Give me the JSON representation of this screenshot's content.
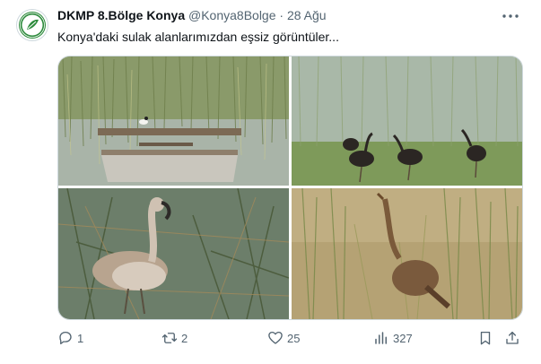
{
  "tweet": {
    "display_name": "DKMP 8.Bölge Konya",
    "handle": "@Konya8Bolge",
    "separator": "·",
    "date": "28 Ağu",
    "text": "Konya'daki sulak alanlarımızdan eşsiz görüntüler...",
    "avatar_icon": "dkmp-logo-icon",
    "photos": [
      {
        "subject": "boat-in-reeds-with-bird",
        "icon": "photo-icon"
      },
      {
        "subject": "glossy-ibises-in-grass",
        "icon": "photo-icon"
      },
      {
        "subject": "young-flamingo-in-marsh",
        "icon": "photo-icon"
      },
      {
        "subject": "heron-among-reeds",
        "icon": "photo-icon"
      }
    ]
  },
  "actions": {
    "reply": {
      "icon": "reply-icon",
      "count": "1"
    },
    "retweet": {
      "icon": "retweet-icon",
      "count": "2"
    },
    "like": {
      "icon": "heart-icon",
      "count": "25"
    },
    "views": {
      "icon": "views-chart-icon",
      "count": "327"
    },
    "bookmark": {
      "icon": "bookmark-icon"
    },
    "share": {
      "icon": "share-icon"
    }
  },
  "colors": {
    "text_primary": "#0f1419",
    "text_secondary": "#536471",
    "border": "#cfd9de",
    "logo_green": "#2e8b3d"
  }
}
